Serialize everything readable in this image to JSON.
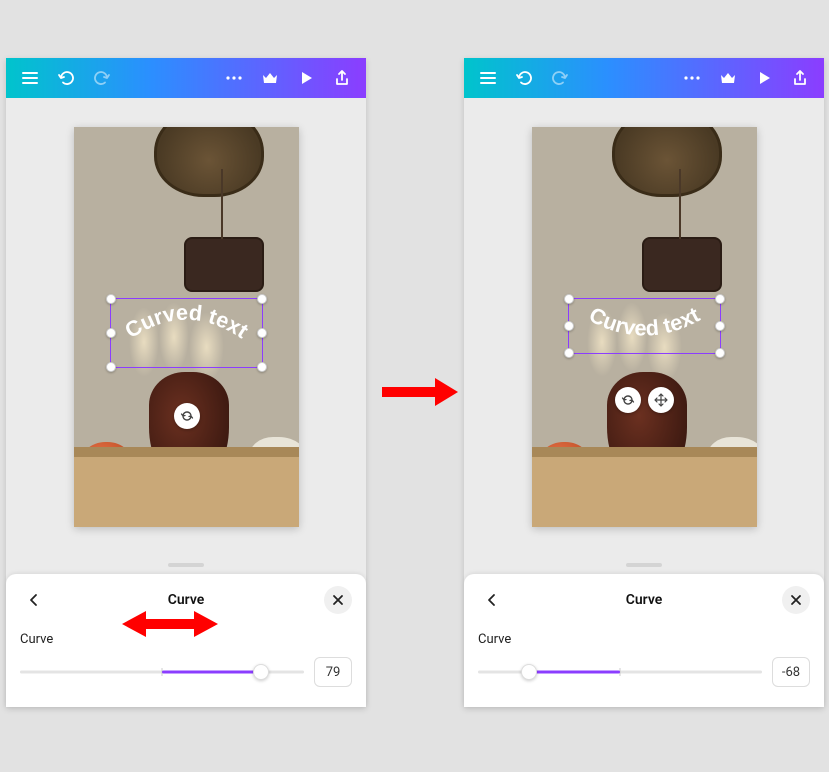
{
  "toolbar": {
    "menu": "menu",
    "undo": "undo",
    "redo": "redo",
    "more": "more",
    "premium": "premium",
    "play": "play",
    "share": "share"
  },
  "canvas": {
    "text_content": "Curved text",
    "rotate": "rotate",
    "move": "move"
  },
  "sheet": {
    "back": "back",
    "title": "Curve",
    "close": "close",
    "slider_label": "Curve"
  },
  "left": {
    "curve_value": "79"
  },
  "right": {
    "curve_value": "-68"
  }
}
